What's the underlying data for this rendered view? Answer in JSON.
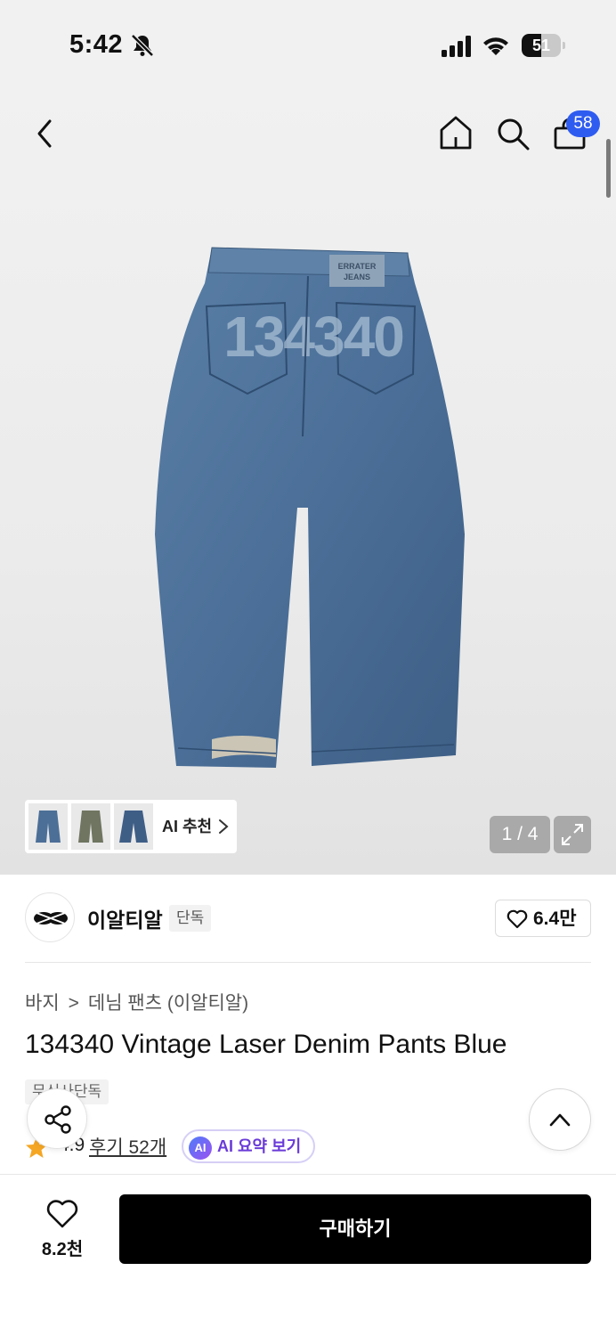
{
  "status_bar": {
    "time": "5:42",
    "battery_percent": 51,
    "battery_label": "51"
  },
  "header": {
    "cart_count": "58"
  },
  "gallery": {
    "ai_recommend_label": "AI 추천",
    "page_indicator": "1 / 4",
    "jeans_print": "134340",
    "jeans_patch": "ERRATER JEANS"
  },
  "brand": {
    "name": "이알티알",
    "exclusive_tag": "단독",
    "like_count": "6.4만"
  },
  "product": {
    "breadcrumb": [
      "바지",
      "데님 팬츠 (이알티알)"
    ],
    "title": "134340 Vintage Laser Denim Pants Blue",
    "tag": "무신사단독",
    "rating": "4.9",
    "reviews_label": "후기 52개",
    "ai_summary_badge": "AI",
    "ai_summary_label": "AI 요약 보기"
  },
  "bottom_bar": {
    "wish_count": "8.2천",
    "buy_label": "구매하기"
  },
  "colors": {
    "accent_blue": "#2f5cf0",
    "star": "#f5a623",
    "ai_purple": "#6a3bd8",
    "button_black": "#000000"
  },
  "icons": [
    "bell-slash-icon",
    "signal-icon",
    "wifi-icon",
    "battery-icon",
    "back-icon",
    "home-icon",
    "search-icon",
    "cart-icon",
    "expand-icon",
    "heart-icon",
    "share-icon",
    "chevron-up-icon",
    "star-icon"
  ]
}
